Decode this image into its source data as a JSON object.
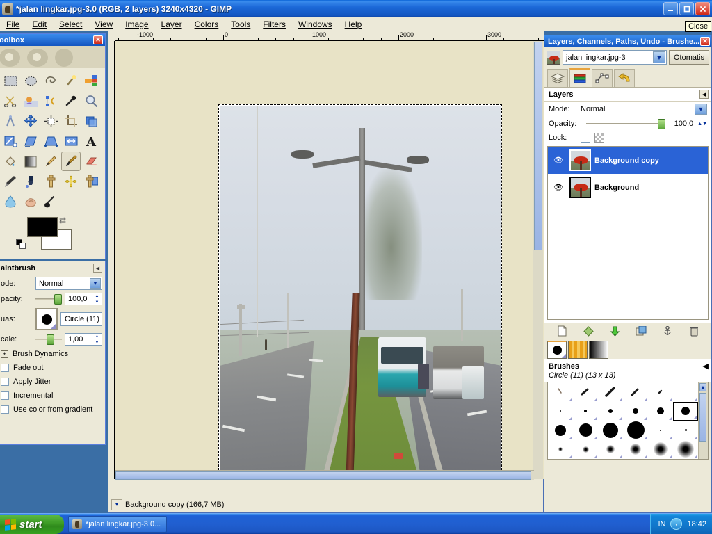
{
  "window": {
    "title": "*jalan lingkar.jpg-3.0 (RGB, 2 layers) 3240x4320 - GIMP",
    "icon": "wilber-icon",
    "minimize": "–",
    "maximize": "❐",
    "close": "✕",
    "close_tooltip": "Close"
  },
  "menubar": {
    "items": [
      {
        "label": "File"
      },
      {
        "label": "Edit"
      },
      {
        "label": "Select"
      },
      {
        "label": "View"
      },
      {
        "label": "Image"
      },
      {
        "label": "Layer"
      },
      {
        "label": "Colors"
      },
      {
        "label": "Tools"
      },
      {
        "label": "Filters"
      },
      {
        "label": "Windows"
      },
      {
        "label": "Help"
      }
    ]
  },
  "toolbox": {
    "title": "oolbox",
    "close": "✕",
    "tools": [
      {
        "name": "rect-select-tool",
        "glyph": "▭"
      },
      {
        "name": "ellipse-select-tool",
        "glyph": "⬭"
      },
      {
        "name": "free-select-tool",
        "glyph": "✂"
      },
      {
        "name": "fuzzy-select-tool",
        "glyph": "✨"
      },
      {
        "name": "select-by-color-tool",
        "glyph": "▦"
      },
      {
        "name": "scissors-select-tool",
        "glyph": "✂"
      },
      {
        "name": "foreground-select-tool",
        "glyph": "◕"
      },
      {
        "name": "paths-tool",
        "glyph": "✒"
      },
      {
        "name": "color-picker-tool",
        "glyph": "💧"
      },
      {
        "name": "zoom-tool",
        "glyph": "🔍"
      },
      {
        "name": "measure-tool",
        "glyph": "⚲"
      },
      {
        "name": "move-tool",
        "glyph": "✥"
      },
      {
        "name": "align-tool",
        "glyph": "⬚"
      },
      {
        "name": "crop-tool",
        "glyph": "⌗"
      },
      {
        "name": "rotate-tool",
        "glyph": "⟳"
      },
      {
        "name": "scale-tool",
        "glyph": "⤢"
      },
      {
        "name": "shear-tool",
        "glyph": "▱"
      },
      {
        "name": "perspective-tool",
        "glyph": "⏢"
      },
      {
        "name": "flip-tool",
        "glyph": "⇔"
      },
      {
        "name": "text-tool",
        "glyph": "A"
      },
      {
        "name": "bucket-fill-tool",
        "glyph": "🪣"
      },
      {
        "name": "blend-gradient-tool",
        "glyph": "▤"
      },
      {
        "name": "pencil-tool",
        "glyph": "✏"
      },
      {
        "name": "paintbrush-tool",
        "glyph": "🖌"
      },
      {
        "name": "eraser-tool",
        "glyph": "▬"
      },
      {
        "name": "airbrush-tool",
        "glyph": "💨"
      },
      {
        "name": "ink-tool",
        "glyph": "🖋"
      },
      {
        "name": "clone-tool",
        "glyph": "⚲"
      },
      {
        "name": "heal-tool",
        "glyph": "✚"
      },
      {
        "name": "perspective-clone-tool",
        "glyph": "⧉"
      },
      {
        "name": "blur-sharpen-tool",
        "glyph": "💧"
      },
      {
        "name": "smudge-tool",
        "glyph": "☞"
      },
      {
        "name": "dodge-burn-tool",
        "glyph": "🥄"
      }
    ],
    "selected_tool_index": 23,
    "foreground_color": "#000000",
    "background_color": "#ffffff",
    "swap_icon": "swap-colors-icon",
    "default_colors_icon": "default-colors-icon"
  },
  "tool_options": {
    "title": "aintbrush",
    "collapse_icon": "◀",
    "mode_label": "ode:",
    "mode_value": "Normal",
    "opacity_label": "pacity:",
    "opacity_value": "100,0",
    "brush_label": "uas:",
    "brush_value": "Circle (11)",
    "scale_label": "cale:",
    "scale_value": "1,00",
    "brush_dynamics_label": "Brush Dynamics",
    "checkboxes": [
      {
        "label": "Fade out",
        "checked": false
      },
      {
        "label": "Apply Jitter",
        "checked": false
      },
      {
        "label": "Incremental",
        "checked": false
      },
      {
        "label": "Use color from gradient",
        "checked": false
      }
    ]
  },
  "image_window": {
    "ruler_labels": [
      "-1000",
      "0",
      "1000",
      "2000",
      "3000"
    ],
    "status_text": "Background copy (166,7 MB)",
    "status_menu_icon": "chevron-down-icon"
  },
  "dock": {
    "title": "Layers, Channels, Paths, Undo - Brushe...",
    "close": "✕",
    "image_name": "jalan lingkar.jpg-3",
    "auto_button": "Otomatis",
    "tabs": [
      {
        "name": "tab-layers",
        "icon": "layers-icon",
        "active": false
      },
      {
        "name": "tab-channels",
        "icon": "channels-icon",
        "active": true
      },
      {
        "name": "tab-paths",
        "icon": "paths-icon",
        "active": false
      },
      {
        "name": "tab-undo-history",
        "icon": "undo-icon",
        "active": false
      }
    ],
    "layers_panel": {
      "title": "Layers",
      "collapse_icon": "◀",
      "mode_label": "Mode:",
      "mode_value": "Normal",
      "opacity_label": "Opacity:",
      "opacity_value": "100,0",
      "lock_label": "Lock:",
      "layers": [
        {
          "name": "Background copy",
          "visible": true,
          "selected": true
        },
        {
          "name": "Background",
          "visible": true,
          "selected": false
        }
      ],
      "buttons": [
        {
          "name": "new-layer-button",
          "icon": "new-layer-icon"
        },
        {
          "name": "raise-layer-button",
          "icon": "raise-layer-icon"
        },
        {
          "name": "lower-layer-button",
          "icon": "lower-layer-icon"
        },
        {
          "name": "duplicate-layer-button",
          "icon": "duplicate-layer-icon"
        },
        {
          "name": "anchor-layer-button",
          "icon": "anchor-layer-icon"
        },
        {
          "name": "delete-layer-button",
          "icon": "delete-layer-icon"
        }
      ]
    },
    "brushes_panel": {
      "tabs": [
        {
          "name": "tab-brushes",
          "icon": "brush-dot-icon",
          "active": true
        },
        {
          "name": "tab-patterns",
          "icon": "pattern-icon",
          "active": false
        },
        {
          "name": "tab-gradients",
          "icon": "gradient-icon",
          "active": false
        }
      ],
      "title": "Brushes",
      "collapse_icon": "◀",
      "selected_brush": "Circle (11) (13 x 13)",
      "grid_selected_index": 11
    }
  },
  "taskbar": {
    "start_label": "start",
    "items": [
      {
        "label": "*jalan lingkar.jpg-3.0...",
        "icon": "wilber-icon"
      }
    ],
    "tray": {
      "language": "IN",
      "chevron": "‹",
      "clock": "18:42"
    }
  }
}
